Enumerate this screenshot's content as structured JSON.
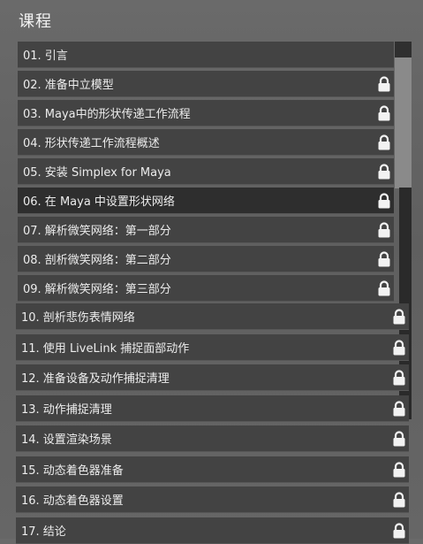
{
  "header": {
    "title": "课程"
  },
  "lessons": [
    {
      "label": "01. 引言",
      "locked": false
    },
    {
      "label": "02. 准备中立模型",
      "locked": true
    },
    {
      "label": "03. Maya中的形状传递工作流程",
      "locked": true
    },
    {
      "label": "04. 形状传递工作流程概述",
      "locked": true
    },
    {
      "label": "05. 安装 Simplex for Maya",
      "locked": true
    },
    {
      "label": "06. 在 Maya 中设置形状网络",
      "locked": true,
      "active": true
    },
    {
      "label": "07. 解析微笑网络：第一部分",
      "locked": true
    },
    {
      "label": "08. 剖析微笑网络：第二部分",
      "locked": true
    },
    {
      "label": "09. 解析微笑网络：第三部分",
      "locked": true
    },
    {
      "label": "10. 剖析悲伤表情网络",
      "locked": true
    },
    {
      "label": "11. 使用 LiveLink 捕捉面部动作",
      "locked": true
    },
    {
      "label": "12. 准备设备及动作捕捉清理",
      "locked": true
    },
    {
      "label": "13. 动作捕捉清理",
      "locked": true
    },
    {
      "label": "14. 设置渲染场景",
      "locked": true
    },
    {
      "label": "15. 动态着色器准备",
      "locked": true
    },
    {
      "label": "16. 动态着色器设置",
      "locked": true
    },
    {
      "label": "17. 结论",
      "locked": true
    }
  ],
  "icons": {
    "lock": "lock-icon"
  },
  "colors": {
    "item_bg": "#434343",
    "active_bg": "#2e2e2e",
    "text": "#ececec"
  }
}
